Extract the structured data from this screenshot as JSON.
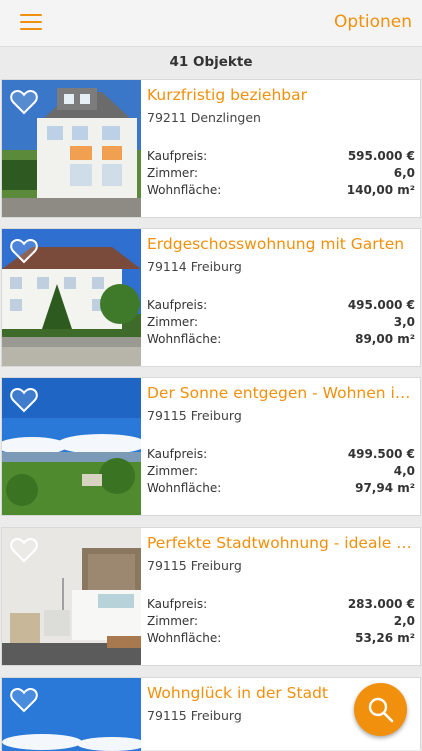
{
  "header": {
    "menu_icon": "hamburger-menu-icon",
    "options_label": "Optionen",
    "accent_color": "#f0900c"
  },
  "results": {
    "count_label": "41 Objekte"
  },
  "labels": {
    "price": "Kaufpreis:",
    "rooms": "Zimmer:",
    "area": "Wohnfläche:"
  },
  "listings": [
    {
      "title": "Kurzfristig beziehbar",
      "location": "79211 Denzlingen",
      "price": "595.000 €",
      "rooms": "6,0",
      "area": "140,00 m²"
    },
    {
      "title": "Erdgeschosswohnung mit Garten",
      "location": "79114 Freiburg",
      "price": "495.000 €",
      "rooms": "3,0",
      "area": "89,00 m²"
    },
    {
      "title": "Der Sonne entgegen - Wohnen in der Natur",
      "location": "79115 Freiburg",
      "price": "499.500 €",
      "rooms": "4,0",
      "area": "97,94 m²"
    },
    {
      "title": "Perfekte Stadtwohnung - ideale Kapitalanlage",
      "location": "79115 Freiburg",
      "price": "283.000 €",
      "rooms": "2,0",
      "area": "53,26 m²"
    },
    {
      "title": "Wohnglück in der Stadt",
      "location": "79115 Freiburg"
    }
  ],
  "fab": {
    "icon": "search-icon"
  }
}
